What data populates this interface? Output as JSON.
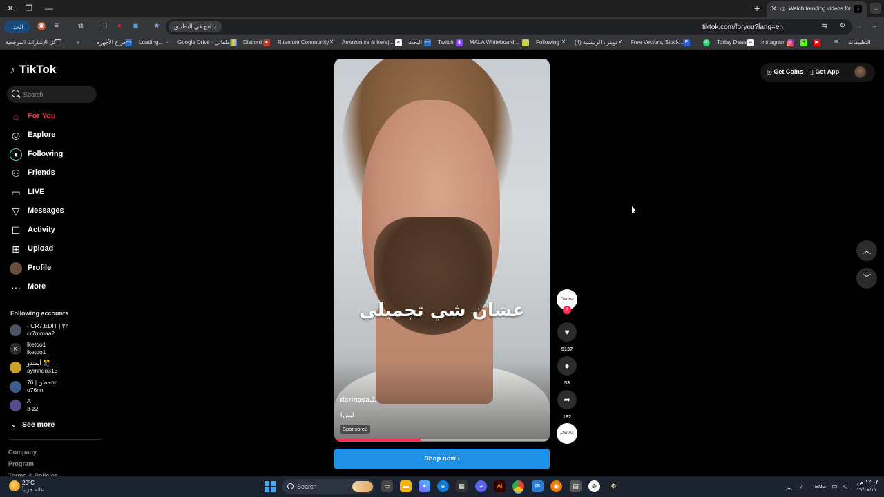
{
  "browser": {
    "tab_title": "Watch trending videos for",
    "url": "tiktok.com/foryou?lang=en",
    "open_in_app": "فتح في التطبيق",
    "update_label": "الحذا",
    "bookmarks": [
      "كل الإشارات المرجعية",
      "حراج الأجهزة",
      "Loading...",
      "Google Drive - ملفاتي",
      "Discord",
      "Ritanium Community",
      "Amazon.sa is here|...",
      "البحث",
      "Twitch",
      "MALA Whiteboard...",
      "Following",
      "(4) تويتر \\ الرئيسية",
      "Free Vectors, Stock...",
      "Today Deals",
      "Instagram",
      "التطبيقات"
    ]
  },
  "sidebar": {
    "logo": "TikTok",
    "search_placeholder": "Search",
    "nav": [
      {
        "label": "For You",
        "icon": "home-icon"
      },
      {
        "label": "Explore",
        "icon": "compass-icon"
      },
      {
        "label": "Following",
        "icon": "following-icon"
      },
      {
        "label": "Friends",
        "icon": "friends-icon"
      },
      {
        "label": "LIVE",
        "icon": "live-icon"
      },
      {
        "label": "Messages",
        "icon": "messages-icon"
      },
      {
        "label": "Activity",
        "icon": "activity-icon"
      },
      {
        "label": "Upload",
        "icon": "upload-icon"
      },
      {
        "label": "Profile",
        "icon": "profile-icon"
      },
      {
        "label": "More",
        "icon": "more-icon"
      }
    ],
    "following_title": "Following accounts",
    "accounts": [
      {
        "name": "‹ CR7.EDIT | ٣٢",
        "handle": "cr7mmaa2"
      },
      {
        "name": "lketoo1",
        "handle": "lketoo1"
      },
      {
        "name": "أيمندو 🎊",
        "handle": "aymndo313"
      },
      {
        "name": "76 | حطنnn",
        "handle": "o76nn"
      },
      {
        "name": "A",
        "handle": "3-z2"
      }
    ],
    "see_more": "See more",
    "footer": [
      "Company",
      "Program",
      "Terms & Policies"
    ]
  },
  "video": {
    "overlay_text": "عشان شي تجميلي",
    "username": "darinasa.1",
    "description": "ليش؟",
    "sponsored": "Sponsored",
    "progress": 0.4,
    "cta": "Shop now"
  },
  "actions": {
    "creator_avatar": "Darina",
    "likes": "5137",
    "comments": "53",
    "shares": "162"
  },
  "topright": {
    "get_coins": "Get Coins",
    "get_app": "Get App"
  },
  "taskbar": {
    "temp": "20°C",
    "weather": "غائم جزئياً",
    "search": "Search",
    "lang": "ENG",
    "time": "١٢:٠٣ ص",
    "date": "٢٧/٠٧/١١"
  },
  "colors": {
    "accent": "#fe2c55",
    "cta": "#1f92e8"
  }
}
